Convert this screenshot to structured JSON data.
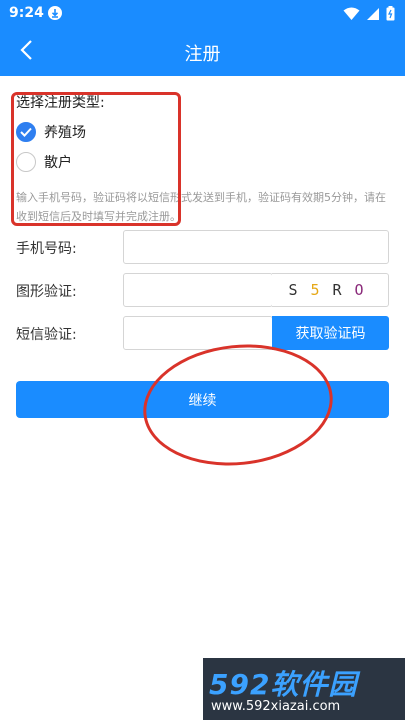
{
  "status_bar": {
    "time": "9:24",
    "download_icon": "download-icon",
    "wifi_icon": "wifi-icon",
    "signal_icon": "signal-icon",
    "battery_icon": "battery-icon"
  },
  "app_bar": {
    "title": "注册",
    "back_icon": "chevron-left-icon"
  },
  "registration_type": {
    "label": "选择注册类型:",
    "options": [
      {
        "label": "养殖场",
        "checked": true
      },
      {
        "label": "散户",
        "checked": false
      }
    ]
  },
  "hint": "输入手机号码，验证码将以短信形式发送到手机，验证码有效期5分钟，请在收到短信后及时填写并完成注册。",
  "form": {
    "phone_label": "手机号码:",
    "phone_value": "",
    "captcha_label": "图形验证:",
    "captcha_value": "",
    "captcha_chars": [
      {
        "char": "S",
        "color": "#333333"
      },
      {
        "char": "5",
        "color": "#e6a817"
      },
      {
        "char": "R",
        "color": "#333333"
      },
      {
        "char": "O",
        "color": "#8a2a7a"
      }
    ],
    "sms_label": "短信验证:",
    "sms_value": "",
    "sms_button": "获取验证码"
  },
  "continue_button": "继续",
  "watermark": {
    "logo": "592软件园",
    "url": "www.592xiazai.com"
  },
  "colors": {
    "primary": "#1a8cff",
    "radio_checked": "#2f7ff0",
    "annotation": "#d9332a"
  }
}
